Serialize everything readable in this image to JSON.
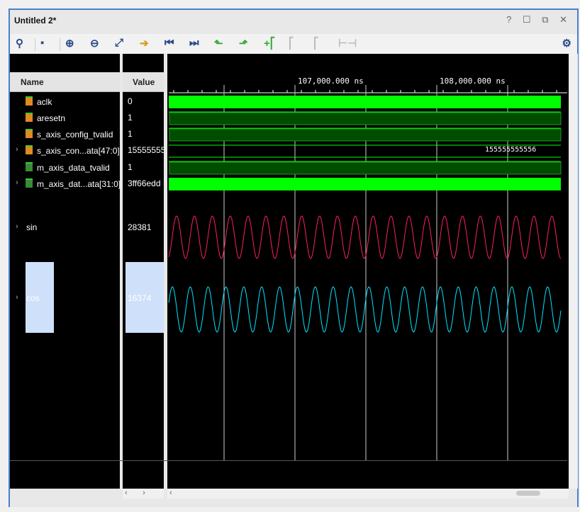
{
  "window": {
    "title": "Untitled 2*",
    "controls": [
      "?",
      "□",
      "↗",
      "✕"
    ]
  },
  "toolbar": [
    "zoom-fit-search",
    "save",
    "zoom-in",
    "zoom-out",
    "full-view",
    "go-to-cursor",
    "go-to-time-0",
    "go-to-last-time",
    "previous-transition",
    "next-transition",
    "add-marker",
    "previous-marker",
    "next-marker",
    "swap-cursors",
    "settings"
  ],
  "columns": {
    "name": "Name",
    "value": "Value"
  },
  "signals": [
    {
      "name": "aclk",
      "value": "0",
      "type": "bit"
    },
    {
      "name": "aresetn",
      "value": "1",
      "type": "bit"
    },
    {
      "name": "s_axis_config_tvalid",
      "value": "1",
      "type": "bit"
    },
    {
      "name": "s_axis_con...ata[47:0]",
      "value": "155555555556",
      "type": "bus"
    },
    {
      "name": "m_axis_data_tvalid",
      "value": "1",
      "type": "bit"
    },
    {
      "name": "m_axis_dat...ata[31:0]",
      "value": "3ff66edd",
      "type": "bus"
    },
    {
      "name": "sin",
      "value": "28381",
      "type": "analog"
    },
    {
      "name": "cos",
      "value": "16374",
      "type": "analog"
    }
  ],
  "timeline": {
    "labels": [
      "107,000.000 ns",
      "108,000.000 ns"
    ]
  },
  "bus_label": "155555555556",
  "colors": {
    "signal": "#00ff00",
    "sin": "#ff1f5a",
    "cos": "#00e5ff",
    "selected": "#cfe0fb"
  }
}
